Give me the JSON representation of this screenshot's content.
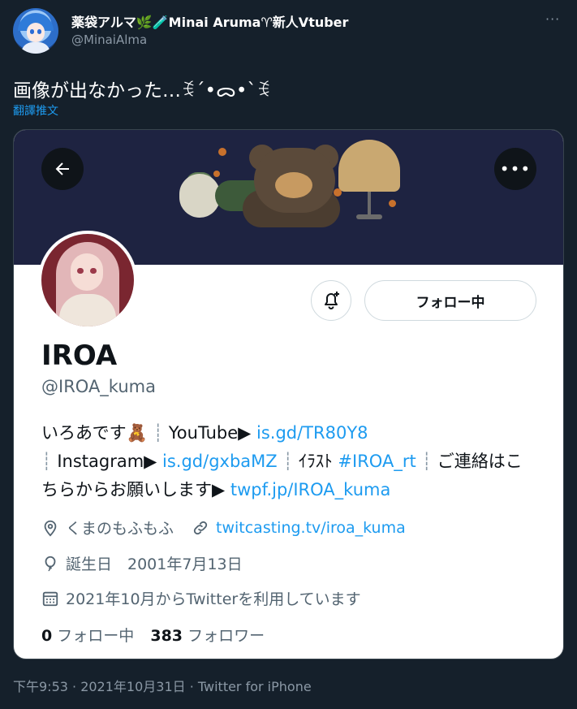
{
  "tweet": {
    "author_name": "薬袋アルマ🌿🧪Minai Aruma♈新人Vtuber",
    "author_handle": "@MinaiAlma",
    "more_label": "···",
    "text": "画像が出なかった…ꉂ´•ᯅ•`ꉂ",
    "translate_label": "翻譯推文",
    "footer": "下午9:53 · 2021年10月31日 · Twitter for iPhone"
  },
  "card": {
    "profile_name": "IROA",
    "profile_handle": "@IROA_kuma",
    "follow_button": "フォロー中",
    "more_label": "•••",
    "bio": {
      "part1": "いろあです🧸",
      "sep1": "┊",
      "yt_label": "YouTube▶",
      "yt_link": "is.gd/TR80Y8",
      "sep2": "┊",
      "ig_label": "Instagram▶",
      "ig_link": "is.gd/gxbaMZ",
      "sep3": "┊",
      "illust_label": "ｲﾗｽﾄ",
      "illust_tag": "#IROA_rt",
      "sep4": "┊",
      "contact_text": "ご連絡はこちらからお願いします▶",
      "contact_link": "twpf.jp/IROA_kuma"
    },
    "location": "くまのもふもふ",
    "website": "twitcasting.tv/iroa_kuma",
    "birthday": "誕生日　2001年7月13日",
    "joined": "2021年10月からTwitterを利用しています",
    "following_count": "0",
    "following_label": "フォロー中",
    "followers_count": "383",
    "followers_label": "フォロワー"
  },
  "colors": {
    "background": "#15202b",
    "accent": "#1d9bf0",
    "banner": "#1e2341"
  }
}
